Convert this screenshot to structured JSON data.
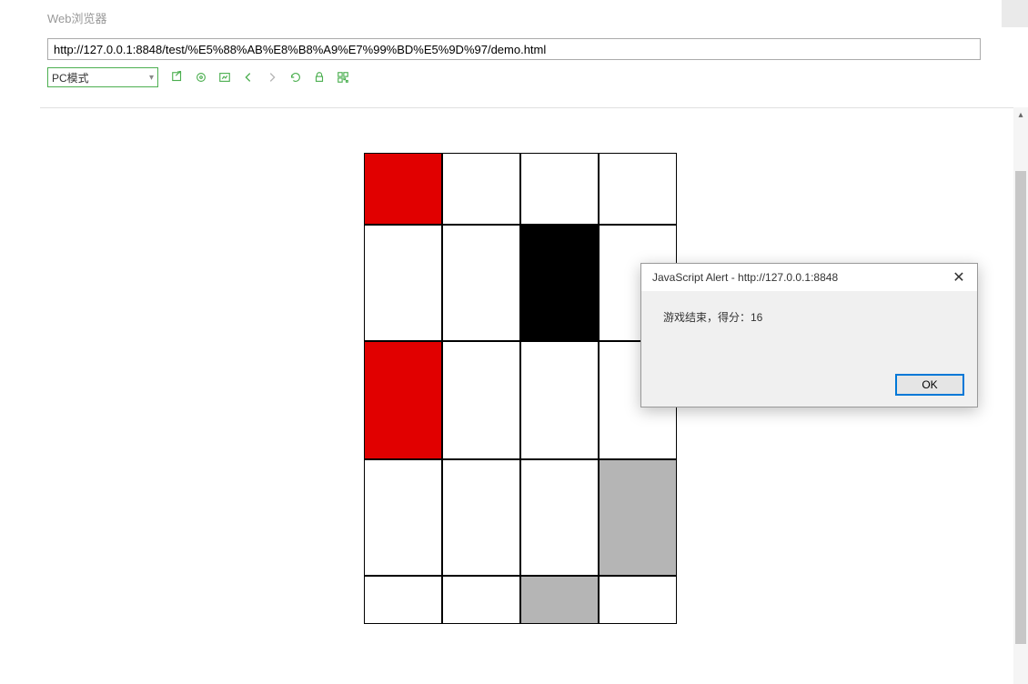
{
  "window": {
    "title": "Web浏览器"
  },
  "url": "http://127.0.0.1:8848/test/%E5%88%AB%E8%B8%A9%E7%99%BD%E5%9D%97/demo.html",
  "toolbar": {
    "mode_label": "PC模式",
    "icons": [
      "open-external",
      "settings",
      "screenshot",
      "back",
      "forward",
      "reload",
      "lock",
      "qr"
    ]
  },
  "game": {
    "grid": [
      [
        "red",
        "white",
        "white",
        "white"
      ],
      [
        "white",
        "white",
        "black",
        "white"
      ],
      [
        "red",
        "white",
        "white",
        "white"
      ],
      [
        "white",
        "white",
        "white",
        "gray"
      ],
      [
        "white",
        "white",
        "gray",
        "white"
      ]
    ]
  },
  "dialog": {
    "title": "JavaScript Alert - http://127.0.0.1:8848",
    "message": "游戏结束，得分：16",
    "ok_label": "OK"
  }
}
